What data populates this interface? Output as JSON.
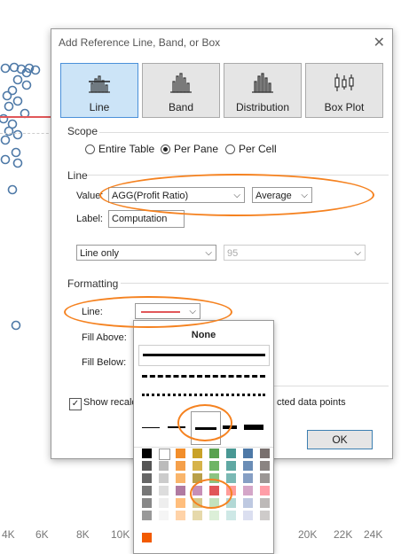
{
  "dialog": {
    "title": "Add Reference Line, Band, or Box",
    "close_icon": "close-icon",
    "types": [
      {
        "label": "Line",
        "icon": "line-chart-icon",
        "selected": true
      },
      {
        "label": "Band",
        "icon": "band-chart-icon",
        "selected": false
      },
      {
        "label": "Distribution",
        "icon": "distribution-chart-icon",
        "selected": false
      },
      {
        "label": "Box Plot",
        "icon": "box-plot-icon",
        "selected": false
      }
    ],
    "scope": {
      "title": "Scope",
      "options": [
        "Entire Table",
        "Per Pane",
        "Per Cell"
      ],
      "selected": "Per Pane"
    },
    "line_section": {
      "title": "Line",
      "value_label": "Value:",
      "value_field": "AGG(Profit Ratio)",
      "aggregation": "Average",
      "label_label": "Label:",
      "label_value": "Computation",
      "line_type": "Line only",
      "confidence": "95"
    },
    "formatting": {
      "title": "Formatting",
      "line_label": "Line:",
      "fill_above": "Fill Above:",
      "fill_below": "Fill Below:",
      "line_color": "#e15759"
    },
    "show_recalc": "Show recalc",
    "highlight_tail": "cted data points",
    "ok": "OK"
  },
  "popup": {
    "none_label": "None",
    "colors_top": [
      "#000000",
      "#ffffff"
    ],
    "selected_color": "#e15759"
  },
  "background": {
    "x_ticks": [
      "4K",
      "6K",
      "8K",
      "10K",
      "20K",
      "22K",
      "24K"
    ],
    "marker_color": "#4e79a7"
  }
}
